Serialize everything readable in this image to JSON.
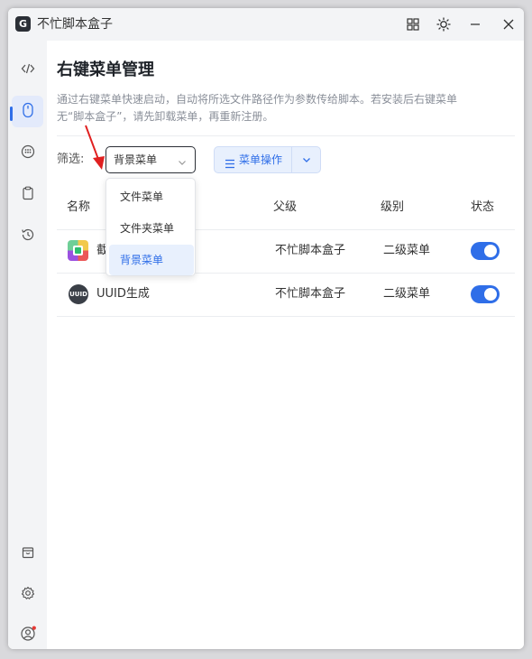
{
  "app": {
    "title": "不忙脚本盒子",
    "logo_letter": "G"
  },
  "page": {
    "title": "右键菜单管理",
    "description_line1": "通过右键菜单快速启动，自动将所选文件路径作为参数传给脚本。若安装后右键菜单",
    "description_line2": "无“脚本盒子”，请先卸载菜单，再重新注册。"
  },
  "filter": {
    "label": "筛选:",
    "selected": "背景菜单",
    "options": [
      "文件菜单",
      "文件夹菜单",
      "背景菜单"
    ]
  },
  "toolbar": {
    "menu_action_label": "菜单操作"
  },
  "table": {
    "headers": {
      "name": "名称",
      "parent": "父级",
      "level": "级别",
      "status": "状态"
    },
    "rows": [
      {
        "name": "截",
        "parent": "不忙脚本盒子",
        "level": "二级菜单",
        "enabled": true
      },
      {
        "name": "UUID生成",
        "parent": "不忙脚本盒子",
        "level": "二级菜单",
        "enabled": true,
        "icon_text": "UUID"
      }
    ]
  },
  "colors": {
    "accent": "#2f6ee8",
    "annotation_arrow": "#e02020",
    "notification_dot": "#e53935"
  }
}
